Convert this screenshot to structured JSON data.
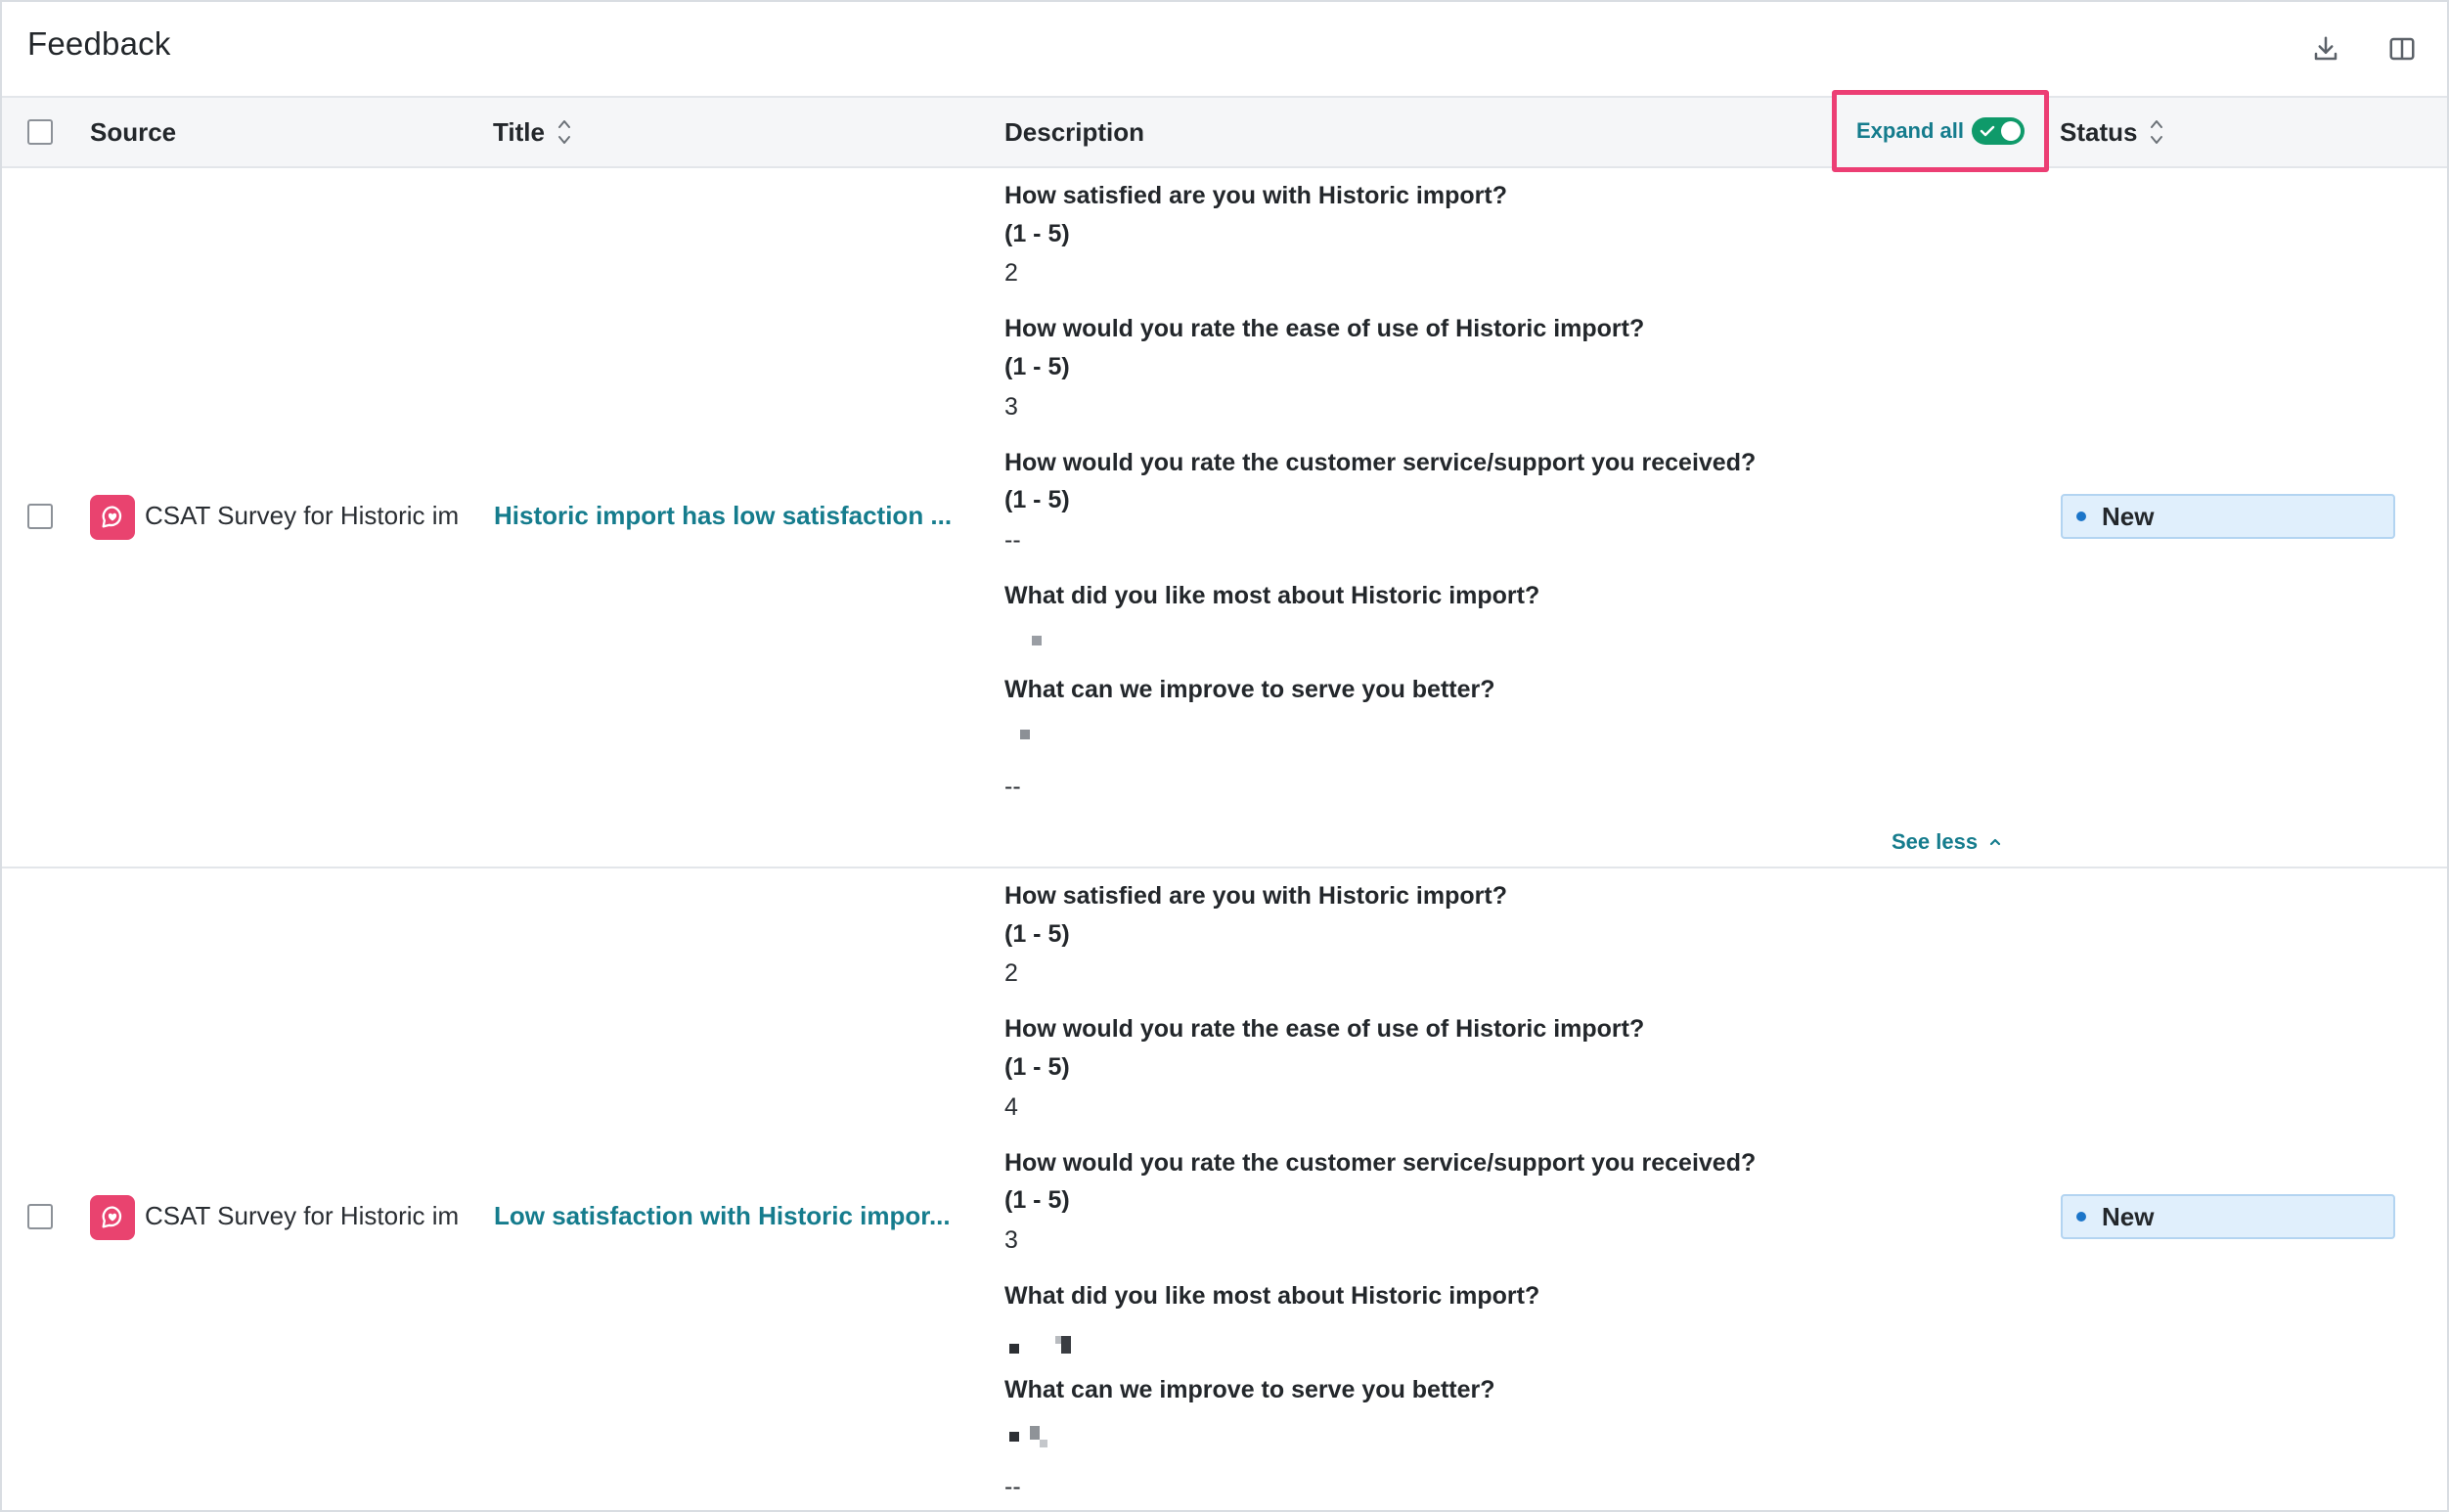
{
  "header": {
    "title": "Feedback",
    "icons": [
      "download-icon",
      "columns-icon"
    ]
  },
  "columns": {
    "source": "Source",
    "title": "Title",
    "description": "Description",
    "status": "Status"
  },
  "expand_all": {
    "label": "Expand all",
    "on": true
  },
  "colors": {
    "accent": "#157c8d",
    "toggle_on": "#0f9a6a",
    "highlight": "#ec3e74",
    "source_icon_bg": "#e9436f",
    "status_bg": "#e0effc"
  },
  "rows": [
    {
      "source": "CSAT Survey for Historic im",
      "title": "Historic import has low satisfaction ...",
      "status": "New",
      "qa": [
        {
          "q": "How satisfied are you with Historic import?",
          "scale": "(1 - 5)",
          "a": "2"
        },
        {
          "q": "How would you rate the ease of use of Historic import?",
          "scale": "(1 - 5)",
          "a": "3"
        },
        {
          "q": "How would you rate the customer service/support you received?",
          "scale": "(1 - 5)",
          "a": "--"
        },
        {
          "q": "What did you like most about Historic import?"
        },
        {
          "q": "What can we improve to serve you better?"
        }
      ],
      "trailing": "--",
      "see_less": "See less"
    },
    {
      "source": "CSAT Survey for Historic im",
      "title": "Low satisfaction with Historic impor...",
      "status": "New",
      "qa": [
        {
          "q": "How satisfied are you with Historic import?",
          "scale": "(1 - 5)",
          "a": "2"
        },
        {
          "q": "How would you rate the ease of use of Historic import?",
          "scale": "(1 - 5)",
          "a": "4"
        },
        {
          "q": "How would you rate the customer service/support you received?",
          "scale": "(1 - 5)",
          "a": "3"
        },
        {
          "q": "What did you like most about Historic import?"
        },
        {
          "q": "What can we improve to serve you better?"
        }
      ],
      "trailing": "--"
    }
  ]
}
